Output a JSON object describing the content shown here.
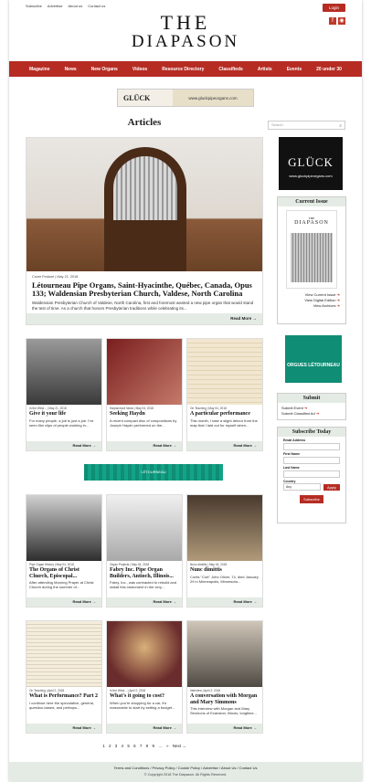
{
  "header": {
    "top_links": [
      "Subscribe",
      "Advertise",
      "About us",
      "Contact us"
    ],
    "login_label": "Login",
    "logo_line1": "THE",
    "logo_line2": "DIAPASON"
  },
  "nav": [
    "Magazine",
    "News",
    "New Organs",
    "Videos",
    "Resource Directory",
    "Classifieds",
    "Artists",
    "Events",
    "20 under 30"
  ],
  "ads": {
    "top_brand": "GLÜCK",
    "top_url": "www.gluckpipeorgans.com",
    "side1_brand": "GLÜCK",
    "side1_url": "www.gluckpipeorgans.com",
    "side2_brand": "ORGUES LÉTOURNEAU",
    "mid_brand": "LÉTOURNEAU"
  },
  "main": {
    "heading": "Articles",
    "search_placeholder": "Search",
    "read_more": "Read More →",
    "feature": {
      "meta": "Cover Feature | May 21, 2018",
      "title": "Létourneau Pipe Organs, Saint-Hyacinthe, Québec, Canada, Opus 133; Waldensian Presbyterian Church, Valdese, North Carolina",
      "excerpt": "Waldensian Presbyterian Church of Valdese, North Carolina, first and foremost wanted a new pipe organ that would stand the test of time. As a church that honors Presbyterian traditions while celebrating its..."
    },
    "cards": [
      {
        "meta": "In the Wind... | May 21, 2018",
        "title": "Give it your life",
        "excerpt": "For many people, a job is just a job. I've seen film clips of people working in..."
      },
      {
        "meta": "Harpsichord News | May 04, 2018",
        "title": "Seeking Haydn",
        "excerpt": "A recent compact disc of compositions by Joseph Haydn performed on the..."
      },
      {
        "meta": "On Teaching | May 04, 2018",
        "title": "A particular performance",
        "excerpt": "This month, I take a slight detour from the map that I laid out for myself when..."
      },
      {
        "meta": "Pipe Organ History | May 04, 2018",
        "title": "The Organs of Christ Church, Episcopal...",
        "excerpt": "After attending Morning Prayer at Christ Church during the summer of..."
      },
      {
        "meta": "Organ Projects | May 04, 2018",
        "title": "Fabry Inc. Pipe Organ Builders, Antioch, Illinois...",
        "excerpt": "Fabry, Inc., was contracted to rebuild and install this instrument in the very..."
      },
      {
        "meta": "Nunc dimittis | May 04, 2018",
        "title": "Nunc dimittis",
        "excerpt": "Curtis \"Curt\" John Oliver, 74, died January 29 in Minneapolis, Minnesota..."
      },
      {
        "meta": "On Teaching | April 2, 2018",
        "title": "What is Performance? Part 2",
        "excerpt": "I continue here the speculative, general, question-based, and perhaps..."
      },
      {
        "meta": "In the Wind... | April 2, 2018",
        "title": "What's it going to cost?",
        "excerpt": "When you're shopping for a car, it's reasonable to start by setting a budget..."
      },
      {
        "meta": "Interview | April 2, 2018",
        "title": "A conversation with Morgan and Mary Simmons",
        "excerpt": "This interview with Morgan and Mary Simmons of Evanston, Illinois, longtime..."
      }
    ],
    "pagination": [
      "1",
      "2",
      "3",
      "4",
      "5",
      "6",
      "7",
      "8",
      "9",
      "…",
      "»",
      "Next →"
    ]
  },
  "sidebar": {
    "current_issue": {
      "heading": "Current Issue",
      "cover_title": "THE",
      "cover_logo": "DIAPASON",
      "links": [
        "View Current Issue",
        "View Digital Edition",
        "View Archives"
      ]
    },
    "submit": {
      "heading": "Submit",
      "items": [
        "Submit Event",
        "Submit Classified Ad"
      ]
    },
    "subscribe": {
      "heading": "Subscribe Today",
      "email_label": "Email Address",
      "first_label": "First Name",
      "last_label": "Last Name",
      "country_label": "Country",
      "country_value": "Any",
      "apply_label": "Apply",
      "subscribe_label": "Subscribe"
    }
  },
  "footer": {
    "links": "Terms and Conditions / Privacy Policy / Cookie Policy / Advertise / About Us / Contact Us",
    "copyright": "© Copyright 2018 The Diapason. All Rights Reserved."
  },
  "colors": {
    "accent": "#b62c23",
    "panel_bg": "#e4ebe4"
  }
}
